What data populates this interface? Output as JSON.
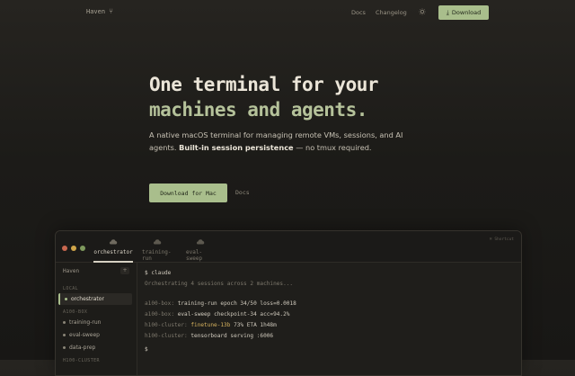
{
  "nav": {
    "brand": "Haven",
    "docs": "Docs",
    "changelog": "Changelog",
    "download": "Download"
  },
  "hero": {
    "title_line1": "One terminal for your",
    "title_line2": "machines and agents.",
    "desc_plain": "A native macOS terminal for managing remote VMs, sessions, and AI agents. ",
    "desc_bold": "Built-in session persistence",
    "desc_tail": " — no tmux required.",
    "cta_primary": "Download for Mac",
    "cta_secondary": "Docs"
  },
  "window": {
    "shortcut": "⌘ Shortcut",
    "tabs": [
      {
        "label": "orchestrator",
        "active": true
      },
      {
        "label": "training-run",
        "active": false
      },
      {
        "label": "eval-sweep",
        "active": false
      }
    ],
    "sidebar": {
      "brand": "Haven",
      "add": "+",
      "sections": [
        "LOCAL",
        "A100-BOX",
        "H100-CLUSTER"
      ],
      "items": [
        "orchestrator",
        "training-run",
        "eval-sweep",
        "data-prep"
      ]
    },
    "terminal": {
      "prompt_cmd": "$ claude",
      "status": "Orchestrating 4 sessions across 2 machines...",
      "rows": [
        {
          "host": "a100-box:",
          "job": "training-run",
          "stat": "epoch 34/50 loss=0.0018",
          "highlight": false
        },
        {
          "host": "a100-box:",
          "job": "eval-sweep",
          "stat": "checkpoint-34 acc=94.2%",
          "highlight": false
        },
        {
          "host": "h100-cluster:",
          "job": "finetune-13b",
          "stat": "73% ETA 1h48m",
          "highlight": true
        },
        {
          "host": "h100-cluster:",
          "job": "tensorboard",
          "stat": "serving :6006",
          "highlight": false
        }
      ],
      "prompt_empty": "$"
    }
  },
  "colors": {
    "accent": "#a9be8c",
    "highlight": "#d8b45f"
  }
}
